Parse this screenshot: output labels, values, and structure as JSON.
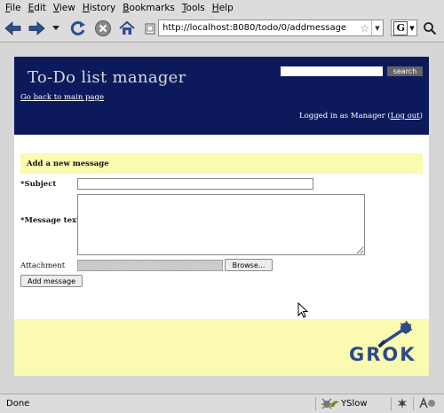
{
  "menu": {
    "items": [
      {
        "underline": "F",
        "rest": "ile"
      },
      {
        "underline": "E",
        "rest": "dit"
      },
      {
        "underline": "V",
        "rest": "iew"
      },
      {
        "underline": "H",
        "rest": "istory"
      },
      {
        "underline": "B",
        "rest": "ookmarks"
      },
      {
        "underline": "T",
        "rest": "ools"
      },
      {
        "underline": "H",
        "rest": "elp"
      }
    ]
  },
  "toolbar": {
    "url": "http://localhost:8080/todo/0/addmessage",
    "search_engine": "G",
    "icons": [
      "back-arrow-icon",
      "forward-arrow-icon",
      "history-dropdown-icon",
      "reload-icon",
      "stop-icon",
      "home-icon",
      "page-icon",
      "bookmark-star-icon",
      "search-icon"
    ]
  },
  "header": {
    "title": "To-Do list manager",
    "back_link": "Go back to main page",
    "search_button": "search",
    "logged_in_prefix": "Logged in as Manager (",
    "logout": "Log out",
    "logged_in_suffix": ")"
  },
  "form": {
    "heading": "Add a new message",
    "subject_label": "*Subject",
    "subject_value": "",
    "message_label": "*Message text",
    "message_value": "",
    "attachment_label": "Attachment",
    "browse_button": "Browse...",
    "submit_button": "Add message"
  },
  "footer": {
    "logo_text": "GROK"
  },
  "status": {
    "text": "Done",
    "yslow": "YSlow"
  },
  "colors": {
    "header_bg": "#0c1a5c",
    "highlight_bg": "#fafab0",
    "logo": "#2b4a8c"
  }
}
